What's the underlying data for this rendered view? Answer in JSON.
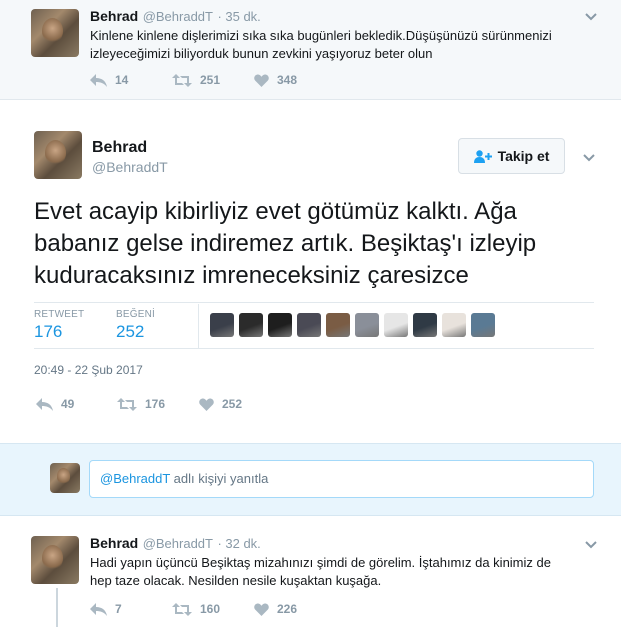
{
  "top_tweet": {
    "name": "Behrad",
    "handle": "@BehraddT",
    "time": "· 35 dk.",
    "text_line1": "Kinlene kinlene dişlerimizi sıka sıka bugünleri bekledik.Düşüşünüzü sürünmenizi",
    "text_line2": "izleyeceğimizi biliyorduk bunun zevkini yaşıyoruz beter olun",
    "replies": "14",
    "retweets": "251",
    "likes": "348"
  },
  "main_tweet": {
    "name": "Behrad",
    "handle": "@BehraddT",
    "follow_label": "Takip et",
    "text": "Evet acayip kibirliyiz evet götümüz kalktı. Ağa babanız gelse indiremez artık. Beşiktaş'ı izleyip kuduracaksınız imreneceksiniz çaresizce",
    "retweet_label": "RETWEET",
    "retweet_count": "176",
    "like_label": "BEĞENİ",
    "like_count": "252",
    "timestamp": "20:49 - 22 Şub 2017",
    "replies": "49",
    "retweets": "176",
    "likes": "252",
    "liker_colors": [
      "#3a3f4a",
      "#2b2b2b",
      "#1e1e1e",
      "#4a4a55",
      "#7a5c44",
      "#8a8f99",
      "#e6e6e6",
      "#2f3a45",
      "#e8e2dc",
      "#5a7a94"
    ]
  },
  "reply": {
    "mention": "@BehraddT",
    "suffix": " adlı kişiyi yanıtla"
  },
  "bottom_tweet": {
    "name": "Behrad",
    "handle": "@BehraddT",
    "time": "· 32 dk.",
    "text_line1": "Hadi yapın üçüncü Beşiktaş mizahınızı şimdi de görelim. İştahımız da kinimiz de",
    "text_line2": "hep taze olacak. Nesilden nesile kuşaktan kuşağa.",
    "replies": "7",
    "retweets": "160",
    "likes": "226"
  },
  "colors": {
    "accent": "#1da1f2",
    "link": "#1b95e0",
    "muted": "#8899a6",
    "reply_bg": "#e8f5fd"
  }
}
